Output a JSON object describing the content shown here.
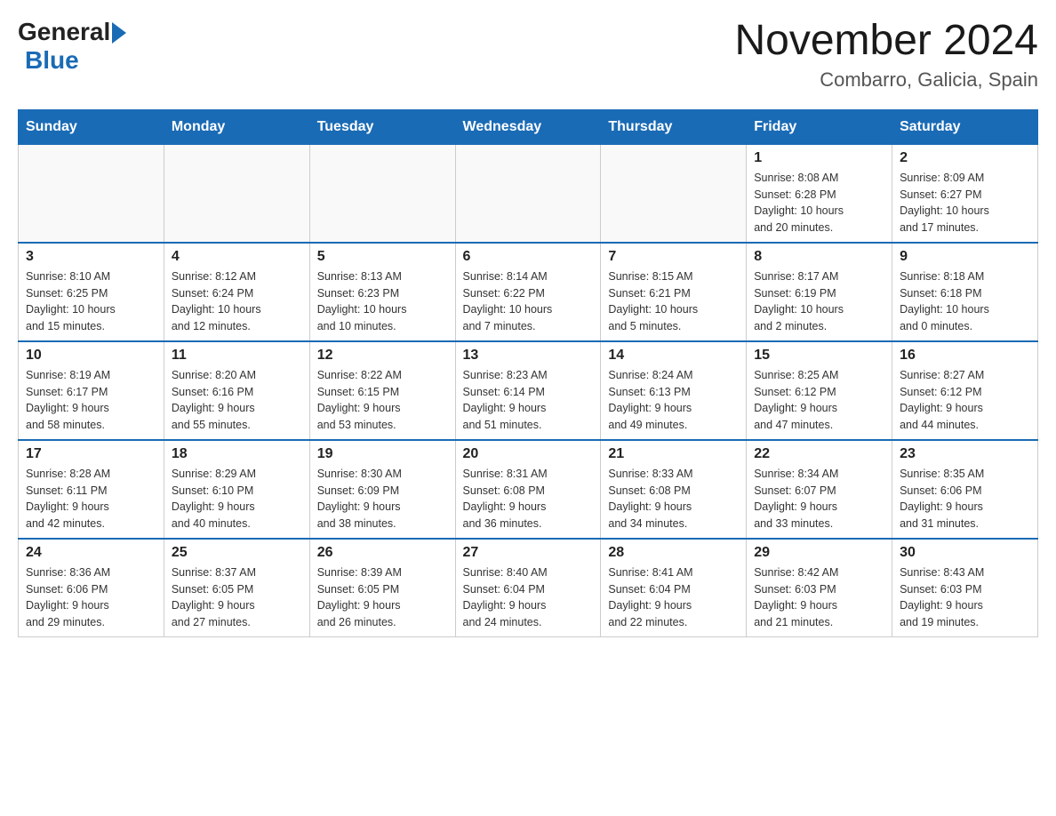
{
  "header": {
    "logo_general": "General",
    "logo_blue": "Blue",
    "title": "November 2024",
    "subtitle": "Combarro, Galicia, Spain"
  },
  "calendar": {
    "days_of_week": [
      "Sunday",
      "Monday",
      "Tuesday",
      "Wednesday",
      "Thursday",
      "Friday",
      "Saturday"
    ],
    "weeks": [
      [
        {
          "day": "",
          "info": ""
        },
        {
          "day": "",
          "info": ""
        },
        {
          "day": "",
          "info": ""
        },
        {
          "day": "",
          "info": ""
        },
        {
          "day": "",
          "info": ""
        },
        {
          "day": "1",
          "info": "Sunrise: 8:08 AM\nSunset: 6:28 PM\nDaylight: 10 hours\nand 20 minutes."
        },
        {
          "day": "2",
          "info": "Sunrise: 8:09 AM\nSunset: 6:27 PM\nDaylight: 10 hours\nand 17 minutes."
        }
      ],
      [
        {
          "day": "3",
          "info": "Sunrise: 8:10 AM\nSunset: 6:25 PM\nDaylight: 10 hours\nand 15 minutes."
        },
        {
          "day": "4",
          "info": "Sunrise: 8:12 AM\nSunset: 6:24 PM\nDaylight: 10 hours\nand 12 minutes."
        },
        {
          "day": "5",
          "info": "Sunrise: 8:13 AM\nSunset: 6:23 PM\nDaylight: 10 hours\nand 10 minutes."
        },
        {
          "day": "6",
          "info": "Sunrise: 8:14 AM\nSunset: 6:22 PM\nDaylight: 10 hours\nand 7 minutes."
        },
        {
          "day": "7",
          "info": "Sunrise: 8:15 AM\nSunset: 6:21 PM\nDaylight: 10 hours\nand 5 minutes."
        },
        {
          "day": "8",
          "info": "Sunrise: 8:17 AM\nSunset: 6:19 PM\nDaylight: 10 hours\nand 2 minutes."
        },
        {
          "day": "9",
          "info": "Sunrise: 8:18 AM\nSunset: 6:18 PM\nDaylight: 10 hours\nand 0 minutes."
        }
      ],
      [
        {
          "day": "10",
          "info": "Sunrise: 8:19 AM\nSunset: 6:17 PM\nDaylight: 9 hours\nand 58 minutes."
        },
        {
          "day": "11",
          "info": "Sunrise: 8:20 AM\nSunset: 6:16 PM\nDaylight: 9 hours\nand 55 minutes."
        },
        {
          "day": "12",
          "info": "Sunrise: 8:22 AM\nSunset: 6:15 PM\nDaylight: 9 hours\nand 53 minutes."
        },
        {
          "day": "13",
          "info": "Sunrise: 8:23 AM\nSunset: 6:14 PM\nDaylight: 9 hours\nand 51 minutes."
        },
        {
          "day": "14",
          "info": "Sunrise: 8:24 AM\nSunset: 6:13 PM\nDaylight: 9 hours\nand 49 minutes."
        },
        {
          "day": "15",
          "info": "Sunrise: 8:25 AM\nSunset: 6:12 PM\nDaylight: 9 hours\nand 47 minutes."
        },
        {
          "day": "16",
          "info": "Sunrise: 8:27 AM\nSunset: 6:12 PM\nDaylight: 9 hours\nand 44 minutes."
        }
      ],
      [
        {
          "day": "17",
          "info": "Sunrise: 8:28 AM\nSunset: 6:11 PM\nDaylight: 9 hours\nand 42 minutes."
        },
        {
          "day": "18",
          "info": "Sunrise: 8:29 AM\nSunset: 6:10 PM\nDaylight: 9 hours\nand 40 minutes."
        },
        {
          "day": "19",
          "info": "Sunrise: 8:30 AM\nSunset: 6:09 PM\nDaylight: 9 hours\nand 38 minutes."
        },
        {
          "day": "20",
          "info": "Sunrise: 8:31 AM\nSunset: 6:08 PM\nDaylight: 9 hours\nand 36 minutes."
        },
        {
          "day": "21",
          "info": "Sunrise: 8:33 AM\nSunset: 6:08 PM\nDaylight: 9 hours\nand 34 minutes."
        },
        {
          "day": "22",
          "info": "Sunrise: 8:34 AM\nSunset: 6:07 PM\nDaylight: 9 hours\nand 33 minutes."
        },
        {
          "day": "23",
          "info": "Sunrise: 8:35 AM\nSunset: 6:06 PM\nDaylight: 9 hours\nand 31 minutes."
        }
      ],
      [
        {
          "day": "24",
          "info": "Sunrise: 8:36 AM\nSunset: 6:06 PM\nDaylight: 9 hours\nand 29 minutes."
        },
        {
          "day": "25",
          "info": "Sunrise: 8:37 AM\nSunset: 6:05 PM\nDaylight: 9 hours\nand 27 minutes."
        },
        {
          "day": "26",
          "info": "Sunrise: 8:39 AM\nSunset: 6:05 PM\nDaylight: 9 hours\nand 26 minutes."
        },
        {
          "day": "27",
          "info": "Sunrise: 8:40 AM\nSunset: 6:04 PM\nDaylight: 9 hours\nand 24 minutes."
        },
        {
          "day": "28",
          "info": "Sunrise: 8:41 AM\nSunset: 6:04 PM\nDaylight: 9 hours\nand 22 minutes."
        },
        {
          "day": "29",
          "info": "Sunrise: 8:42 AM\nSunset: 6:03 PM\nDaylight: 9 hours\nand 21 minutes."
        },
        {
          "day": "30",
          "info": "Sunrise: 8:43 AM\nSunset: 6:03 PM\nDaylight: 9 hours\nand 19 minutes."
        }
      ]
    ]
  }
}
